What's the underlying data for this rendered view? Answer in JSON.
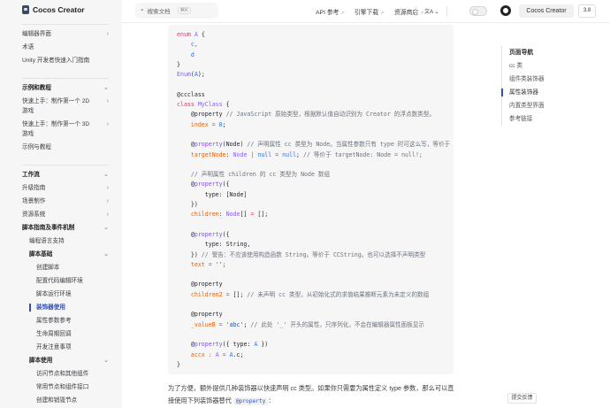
{
  "app": {
    "logo_text": "Cocos Creator"
  },
  "sidebar": {
    "sections": [
      {
        "items": [
          {
            "label": "编辑器界面",
            "level": 0,
            "chev": "›"
          },
          {
            "label": "术语",
            "level": 0
          },
          {
            "label": "Unity 开发者快速入门指南",
            "level": 0
          }
        ]
      },
      {
        "items": [
          {
            "label": "示例和教程",
            "level": 0,
            "head": true,
            "chev": "⌄"
          },
          {
            "label": "快速上手：制作第一个 2D 游戏",
            "level": 0,
            "chev": "›"
          },
          {
            "label": "快速上手：制作第一个 3D 游戏",
            "level": 0,
            "chev": "›"
          },
          {
            "label": "示例与教程",
            "level": 0
          }
        ]
      },
      {
        "items": [
          {
            "label": "工作流",
            "level": 0,
            "head": true,
            "chev": "⌄"
          },
          {
            "label": "升级指南",
            "level": 0,
            "chev": "›"
          },
          {
            "label": "场景制作",
            "level": 0,
            "chev": "›"
          },
          {
            "label": "资源系统",
            "level": 0,
            "chev": "›"
          },
          {
            "label": "脚本指南及事件机制",
            "level": 0,
            "head": true,
            "chev": "⌄"
          },
          {
            "label": "编程语言支持",
            "level": 1
          },
          {
            "label": "脚本基础",
            "level": 1,
            "head": true,
            "chev": "⌄"
          },
          {
            "label": "创建脚本",
            "level": 2
          },
          {
            "label": "配置代码编辑环境",
            "level": 2
          },
          {
            "label": "脚本运行环境",
            "level": 2
          },
          {
            "label": "装饰器使用",
            "level": 2,
            "active": true
          },
          {
            "label": "属性参数参考",
            "level": 2
          },
          {
            "label": "生命周期回调",
            "level": 2
          },
          {
            "label": "开发注意事项",
            "level": 2
          },
          {
            "label": "脚本使用",
            "level": 1,
            "head": true,
            "chev": "⌄"
          },
          {
            "label": "访问节点和其他组件",
            "level": 2
          },
          {
            "label": "常用节点和组件接口",
            "level": 2
          },
          {
            "label": "创建和销毁节点",
            "level": 2
          }
        ]
      }
    ]
  },
  "header": {
    "search_placeholder": "搜索文档",
    "search_shortcut": "⌘K",
    "nav": [
      {
        "label": "API 参考",
        "arrow": "↗"
      },
      {
        "label": "引擎下载",
        "arrow": "↗"
      },
      {
        "label": "资源商店",
        "arrow": "↗"
      }
    ],
    "translate_icon": "文A ⌄",
    "product_button": "Cocos Creator",
    "version": "3.8"
  },
  "code": [
    [
      [
        "enum ",
        "kw"
      ],
      [
        "A",
        "ty"
      ],
      [
        " {",
        "pl"
      ]
    ],
    [
      [
        "    c,",
        "nu"
      ]
    ],
    [
      [
        "    d",
        "nu"
      ]
    ],
    [
      [
        "}",
        "pl"
      ]
    ],
    [
      [
        "Enum",
        "ty"
      ],
      [
        "(",
        "pl"
      ],
      [
        "A",
        "nu"
      ],
      [
        ");",
        "pl"
      ]
    ],
    [],
    [
      [
        "@ccclass",
        "pl"
      ]
    ],
    [
      [
        "class ",
        "kw"
      ],
      [
        "MyClass",
        "ty"
      ],
      [
        " {",
        "pl"
      ]
    ],
    [
      [
        "    @property ",
        "pl"
      ],
      [
        "// JavaScript 原始类型，根据默认值自动识别为 Creator 的浮点数类型。",
        "cm"
      ]
    ],
    [
      [
        "    index",
        "pr"
      ],
      [
        " = ",
        "op"
      ],
      [
        "0",
        "nu"
      ],
      [
        ";",
        "pl"
      ]
    ],
    [],
    [
      [
        "    @",
        "pl"
      ],
      [
        "property",
        "dc"
      ],
      [
        "(Node) ",
        "pl"
      ],
      [
        "// 声明属性 cc 类型为 Node。当属性参数只有 type 时可这么写，等价于 (",
        "cm"
      ]
    ],
    [
      [
        "    targetNode",
        "pr"
      ],
      [
        ": ",
        "pl"
      ],
      [
        "Node",
        "ty"
      ],
      [
        " | ",
        "op"
      ],
      [
        "null",
        "nu"
      ],
      [
        " = ",
        "op"
      ],
      [
        "null",
        "nu"
      ],
      [
        "; ",
        "pl"
      ],
      [
        "// 等价于 targetNode: Node = null!;",
        "cm"
      ]
    ],
    [],
    [
      [
        "    // 声明属性 children 的 cc 类型为 Node 数组",
        "cm"
      ]
    ],
    [
      [
        "    @",
        "pl"
      ],
      [
        "property",
        "dc"
      ],
      [
        "({",
        "pl"
      ]
    ],
    [
      [
        "        type: [Node]",
        "pl"
      ]
    ],
    [
      [
        "    })",
        "pl"
      ]
    ],
    [
      [
        "    children",
        "pr"
      ],
      [
        ": ",
        "pl"
      ],
      [
        "Node",
        "ty"
      ],
      [
        "[] ",
        "pl"
      ],
      [
        "= ",
        "op"
      ],
      [
        "[];",
        "pl"
      ]
    ],
    [],
    [
      [
        "    @",
        "pl"
      ],
      [
        "property",
        "dc"
      ],
      [
        "({",
        "pl"
      ]
    ],
    [
      [
        "        type: String,",
        "pl"
      ]
    ],
    [
      [
        "    }) ",
        "pl"
      ],
      [
        "// 警告：不应该使用构造函数 String。等价于 CCString。也可以选择不声明类型",
        "cm"
      ]
    ],
    [
      [
        "    text",
        "pr"
      ],
      [
        " = ",
        "op"
      ],
      [
        "'';",
        "st"
      ]
    ],
    [],
    [
      [
        "    @property",
        "pl"
      ]
    ],
    [
      [
        "    children2",
        "pr"
      ],
      [
        " = ",
        "op"
      ],
      [
        "[]; ",
        "pl"
      ],
      [
        "// 未声明 cc 类型，从初始化式的求值结果推断元素为未定义的数组",
        "cm"
      ]
    ],
    [],
    [
      [
        "    @property",
        "pl"
      ]
    ],
    [
      [
        "    _valueB",
        "pr"
      ],
      [
        " = ",
        "op"
      ],
      [
        "'abc'",
        "st"
      ],
      [
        "; ",
        "pl"
      ],
      [
        "// 此处 '_' 开头的属性，只序列化，不会在编辑器属性面板显示",
        "cm"
      ]
    ],
    [],
    [
      [
        "    @",
        "pl"
      ],
      [
        "property",
        "dc"
      ],
      [
        "({ type: ",
        "pl"
      ],
      [
        "A",
        "nu"
      ],
      [
        " })",
        "pl"
      ]
    ],
    [
      [
        "    accx",
        "pr"
      ],
      [
        " : ",
        "op"
      ],
      [
        "A",
        "ty"
      ],
      [
        " = ",
        "op"
      ],
      [
        "A",
        "nu"
      ],
      [
        ".c;",
        "pl"
      ]
    ],
    [
      [
        "}",
        "pl"
      ]
    ]
  ],
  "paragraph": {
    "text": "为了方便，额外提供几种装饰器以快速声明 cc 类型。如果你只需要为属性定义 type 参数，那么可以直接使用下列装饰器替代 ",
    "code": "@property",
    "end": "："
  },
  "toc": {
    "title": "页面导航",
    "items": [
      {
        "label": "cc 类"
      },
      {
        "label": "组件类装饰器"
      },
      {
        "label": "属性装饰器",
        "active": true
      },
      {
        "label": "内置类型界面"
      },
      {
        "label": "参考链接"
      }
    ]
  },
  "feedback": "提交反馈",
  "colors": {
    "accent": "#3451b2",
    "sidebar_bg": "#f6f6f7",
    "code_bg": "#f6f6f7"
  }
}
